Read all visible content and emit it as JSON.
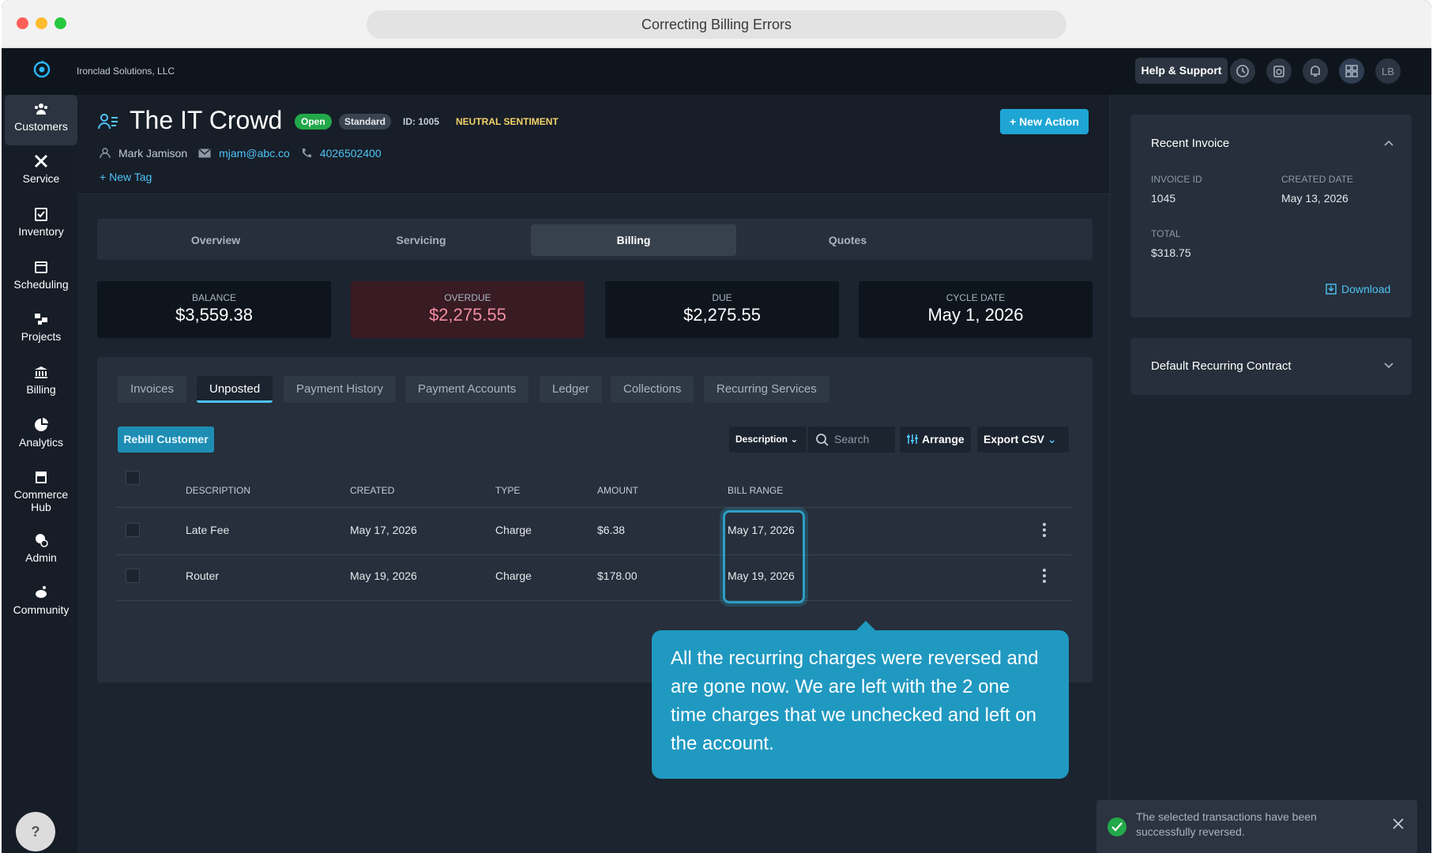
{
  "window": {
    "url_title": "Correcting Billing Errors"
  },
  "topnav": {
    "company": "Ironclad Solutions, LLC",
    "help_label": "Help & Support",
    "avatar_initials": "LB",
    "icons": [
      "history-icon",
      "timer-icon",
      "bell-icon",
      "dashboard-icon"
    ]
  },
  "sidebar": {
    "items": [
      {
        "label": "Customers",
        "icon": "customers-icon",
        "active": true
      },
      {
        "label": "Service",
        "icon": "tools-icon"
      },
      {
        "label": "Inventory",
        "icon": "inventory-icon"
      },
      {
        "label": "Scheduling",
        "icon": "calendar-icon"
      },
      {
        "label": "Projects",
        "icon": "projects-icon"
      },
      {
        "label": "Billing",
        "icon": "bank-icon"
      },
      {
        "label": "Analytics",
        "icon": "pie-chart-icon"
      },
      {
        "label": "Commerce\nHub",
        "label1": "Commerce",
        "label2": "Hub",
        "icon": "store-icon"
      },
      {
        "label": "Admin",
        "icon": "admin-icon"
      },
      {
        "label": "Community",
        "icon": "community-icon"
      }
    ],
    "help": "?"
  },
  "customer": {
    "name": "The IT Crowd",
    "status": "Open",
    "plan": "Standard",
    "id": "ID: 1005",
    "sentiment": "NEUTRAL SENTIMENT",
    "contact_name": "Mark Jamison",
    "email": "mjam@abc.co",
    "phone": "4026502400",
    "new_tag": "New Tag",
    "new_action": "New Action"
  },
  "tabs": [
    {
      "label": "Overview"
    },
    {
      "label": "Servicing"
    },
    {
      "label": "Billing",
      "active": true
    },
    {
      "label": "Quotes"
    }
  ],
  "stats": [
    {
      "label": "BALANCE",
      "value": "$3,559.38"
    },
    {
      "label": "OVERDUE",
      "value": "$2,275.55"
    },
    {
      "label": "DUE",
      "value": "$2,275.55"
    },
    {
      "label": "CYCLE DATE",
      "value": "May 1, 2026"
    }
  ],
  "subtabs": [
    {
      "label": "Invoices"
    },
    {
      "label": "Unposted",
      "active": true
    },
    {
      "label": "Payment History"
    },
    {
      "label": "Payment Accounts"
    },
    {
      "label": "Ledger"
    },
    {
      "label": "Collections"
    },
    {
      "label": "Recurring Services"
    }
  ],
  "toolbar": {
    "rebill": "Rebill Customer",
    "filter_field": "Description",
    "search_placeholder": "Search",
    "arrange": "Arrange",
    "export": "Export CSV"
  },
  "table": {
    "headers": [
      "DESCRIPTION",
      "CREATED",
      "TYPE",
      "AMOUNT",
      "BILL RANGE"
    ],
    "rows": [
      {
        "description": "Late Fee",
        "created": "May 17, 2026",
        "type": "Charge",
        "amount": "$6.38",
        "bill_range": "May 17, 2026"
      },
      {
        "description": "Router",
        "created": "May 19, 2026",
        "type": "Charge",
        "amount": "$178.00",
        "bill_range": "May 19, 2026"
      }
    ]
  },
  "callout": "All the recurring charges were reversed and are gone now. We are left with the 2 one time charges that we unchecked and left on the account.",
  "recent_invoice": {
    "title": "Recent Invoice",
    "invoice_id_label": "INVOICE ID",
    "invoice_id": "1045",
    "created_label": "CREATED DATE",
    "created": "May 13, 2026",
    "total_label": "TOTAL",
    "total": "$318.75",
    "download": "Download"
  },
  "recurring_contract": {
    "title": "Default Recurring Contract"
  },
  "toast": {
    "message": "The selected transactions have been successfully reversed."
  },
  "colors": {
    "accent": "#1ea5d4",
    "open": "#23a84a",
    "overdue": "#f28da0",
    "sentiment": "#f4d36a"
  }
}
